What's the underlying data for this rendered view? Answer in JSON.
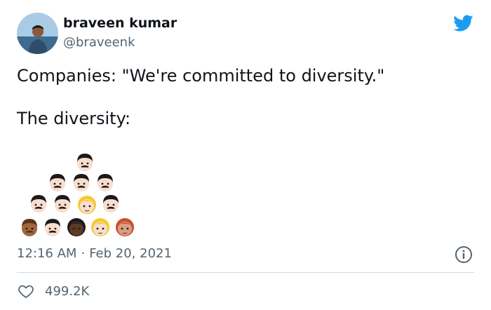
{
  "author": {
    "name": "braveen kumar",
    "handle": "@braveenk"
  },
  "tweet": {
    "line1": "Companies: \"We're committed to diversity.\"",
    "line2": "The diversity:"
  },
  "emoji_faces": [
    {
      "skin": "light",
      "hair": "black",
      "mustache": true
    },
    {
      "skin": "light",
      "hair": "black",
      "mustache": true
    },
    {
      "skin": "light",
      "hair": "black",
      "mustache": true
    },
    {
      "skin": "light",
      "hair": "black",
      "mustache": true
    },
    {
      "skin": "light",
      "hair": "black",
      "mustache": true
    },
    {
      "skin": "light",
      "hair": "black",
      "mustache": true
    },
    {
      "skin": "light",
      "hair": "blond",
      "mustache": false
    },
    {
      "skin": "light",
      "hair": "black",
      "mustache": true
    },
    {
      "skin": "medium-dark",
      "hair": "brown",
      "mustache": true
    },
    {
      "skin": "light",
      "hair": "black",
      "mustache": true
    },
    {
      "skin": "dark",
      "hair": "black",
      "mustache": false
    },
    {
      "skin": "light",
      "hair": "blond",
      "mustache": false
    },
    {
      "skin": "medium",
      "hair": "red",
      "mustache": false
    }
  ],
  "meta": {
    "time": "12:16 AM",
    "separator": "·",
    "date": "Feb 20, 2021"
  },
  "engagement": {
    "likes": "499.2K"
  },
  "colors": {
    "twitter_blue": "#1d9bf0",
    "text_primary": "#0f1419",
    "text_secondary": "#536471",
    "divider": "#cfd9de"
  },
  "icons": {
    "brand": "twitter-bird-icon",
    "info": "info-icon",
    "like": "heart-icon"
  }
}
